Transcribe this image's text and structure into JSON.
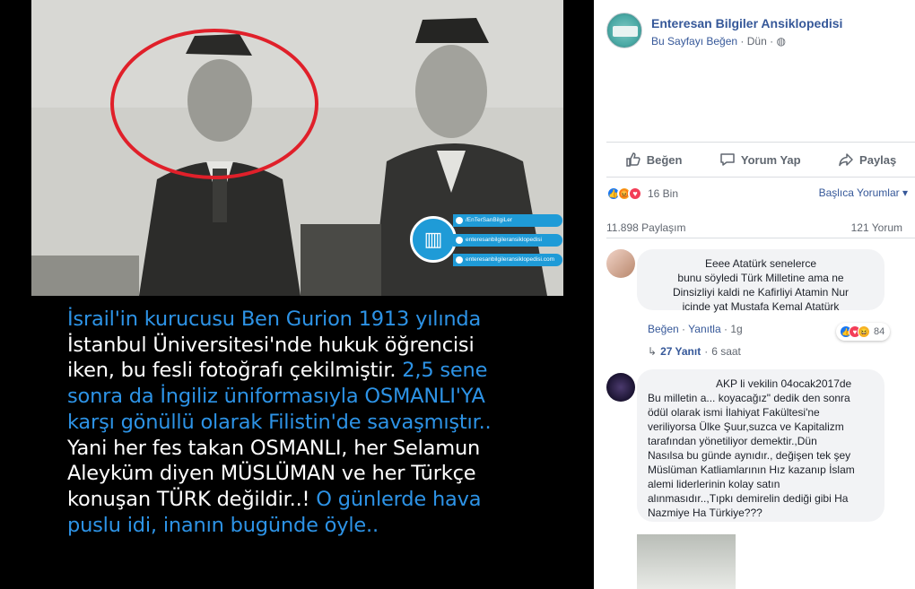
{
  "photo": {
    "watermark": {
      "line1": "/EnTerSanBilgiLer",
      "line2": "enteresanbilgileransiklopedisi",
      "line3": "enteresanbilgileransiklopedisi.com"
    },
    "caption": {
      "l1": "İsrail'in kurucusu Ben Gurion 1913 yılında",
      "l2": "İstanbul Üniversitesi'nde hukuk öğrencisi",
      "l3a": "iken, bu fesli fotoğrafı çekilmiştir.",
      "l3b": " 2,5 sene",
      "l4": "sonra da İngiliz üniformasıyla OSMANLI'YA",
      "l5": "karşı gönüllü olarak Filistin'de savaşmıştır..",
      "l6": "Yani her fes takan OSMANLI, her Selamun",
      "l7": "Aleyküm diyen MÜSLÜMAN ve her Türkçe",
      "l8a": "konuşan TÜRK değildir..!",
      "l8b": " O günlerde hava",
      "l9": "puslu idi, inanın bugünde öyle.."
    }
  },
  "post": {
    "page_name": "Enteresan Bilgiler Ansiklopedisi",
    "like_page": "Bu Sayfayı Beğen",
    "time": "Dün",
    "actions": {
      "like": "Beğen",
      "comment": "Yorum Yap",
      "share": "Paylaş"
    },
    "reactions_count": "16 Bin",
    "sort_label": "Başlıca Yorumlar",
    "shares": "11.898 Paylaşım",
    "comments_count": "121 Yorum"
  },
  "comments": [
    {
      "lines": [
        "Eeee Atatürk senelerce",
        "bunu söyledi Türk Milletine ama ne",
        "Dinsizliyi kaldi ne Kafirliyi Atamin Nur",
        "icinde yat Mustafa Kemal Atatürk"
      ],
      "like": "Beğen",
      "reply": "Yanıtla",
      "time": "1g",
      "reaction_count": "84",
      "replies": "27 Yanıt",
      "replies_time": "6 saat"
    },
    {
      "lines": [
        "AKP li vekilin 04ocak2017de",
        "Bu milletin a... koyacağız\" dedik den sonra",
        "ödül olarak ismi İlahiyat Fakültesi'ne",
        "veriliyorsa Ülke Şuur,suzca ve Kapitalizm",
        "tarafından yönetiliyor demektir.,Dün",
        "Nasılsa bu günde aynıdır., değişen tek şey",
        "Müslüman Katliamlarının Hız kazanıp İslam",
        "alemi liderlerinin kolay satın",
        "alınmasıdır..,Tıpkı demirelin dediği gibi Ha",
        "Nazmiye Ha Türkiye???"
      ]
    }
  ],
  "colors": {
    "link": "#365899",
    "caption_highlight": "#2d93e6",
    "marker": "#e0202a"
  }
}
